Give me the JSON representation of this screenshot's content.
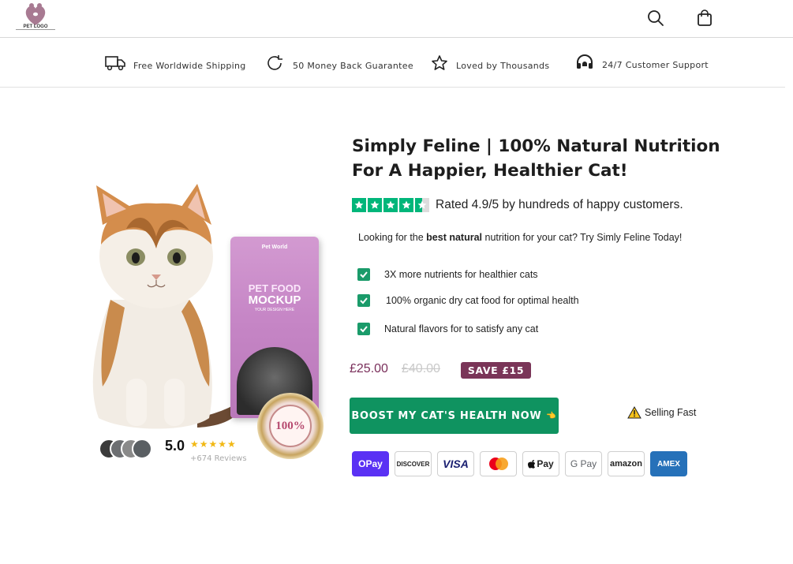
{
  "header": {
    "logo_text": "PET LOGO",
    "search_icon": "search-icon",
    "cart_icon": "shopping-bag-icon"
  },
  "benefits": [
    {
      "label": "Free Worldwide Shipping",
      "icon": "truck-icon"
    },
    {
      "label": "50 Money Back Guarantee",
      "icon": "refresh-icon"
    },
    {
      "label": "Loved by  Thousands",
      "icon": "star-outline-icon"
    },
    {
      "label": "24/7 Customer Support",
      "icon": "headset-icon"
    }
  ],
  "hero": {
    "bag_brand": "Pet World",
    "bag_title_1": "PET FOOD",
    "bag_title_2": "MOCKUP",
    "bag_subtitle": "YOUR DESIGN HERE",
    "seal_text": "100%"
  },
  "reviews": {
    "score": "5.0",
    "stars": "★★★★★",
    "count": "+674 Reviews"
  },
  "product": {
    "title": "Simply Feline | 100% Natural Nutrition For A Happier, Healthier Cat!",
    "rating_text": "Rated 4.9/5 by hundreds of happy customers.",
    "intro_before": "Looking for the ",
    "intro_bold": "best natural",
    "intro_after": " nutrition for your cat? Try Simly Feline Today!",
    "features": [
      "3X more nutrients for healthier cats",
      "100% organic dry cat food for optimal health",
      "Natural flavors for to satisfy any cat"
    ],
    "price_now": "£25.00",
    "price_old": "£40.00",
    "save_label": "SAVE £15",
    "cta_label": "BOOST MY CAT'S HEALTH NOW",
    "cta_emoji": "👈",
    "selling_label": "Selling Fast"
  },
  "payments": [
    "OPay",
    "DISCOVER",
    "VISA",
    "Mastercard",
    "Pay",
    "G Pay",
    "amazon",
    "AMEX"
  ],
  "colors": {
    "accent_green": "#0f9360",
    "price_plum": "#7a2f5b",
    "trustpilot_green": "#00b67a"
  }
}
